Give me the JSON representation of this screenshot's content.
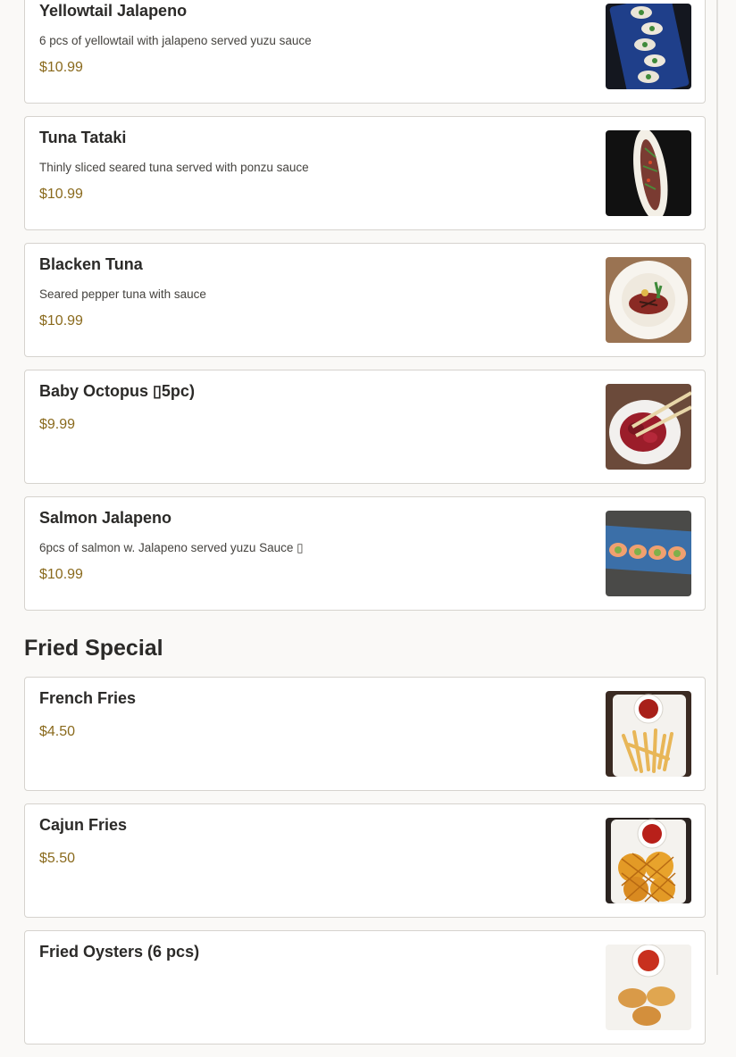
{
  "sections": [
    {
      "title": "",
      "items": [
        {
          "name": "Yellowtail Jalapeno",
          "desc": "6 pcs of yellowtail with jalapeno served yuzu sauce",
          "price": "$10.99",
          "image": "yellowtail-jalapeno-photo"
        },
        {
          "name": "Tuna Tataki",
          "desc": "Thinly sliced seared tuna served with ponzu sauce",
          "price": "$10.99",
          "image": "tuna-tataki-photo"
        },
        {
          "name": "Blacken Tuna",
          "desc": "Seared pepper tuna with sauce",
          "price": "$10.99",
          "image": "blacken-tuna-photo"
        },
        {
          "name": "Baby Octopus ▯5pc)",
          "desc": "",
          "price": "$9.99",
          "image": "baby-octopus-photo"
        },
        {
          "name": "Salmon Jalapeno",
          "desc": "6pcs of salmon w. Jalapeno served yuzu Sauce ▯",
          "price": "$10.99",
          "image": "salmon-jalapeno-photo"
        }
      ]
    },
    {
      "title": "Fried Special",
      "items": [
        {
          "name": "French Fries",
          "desc": "",
          "price": "$4.50",
          "image": "french-fries-photo"
        },
        {
          "name": "Cajun Fries",
          "desc": "",
          "price": "$5.50",
          "image": "cajun-fries-photo"
        },
        {
          "name": "Fried Oysters (6 pcs)",
          "desc": "",
          "price": "",
          "image": "fried-oysters-photo"
        }
      ]
    }
  ],
  "colors": {
    "price": "#8a6a1d",
    "card_border": "#d6d3ce",
    "page_background": "#faf9f7"
  }
}
